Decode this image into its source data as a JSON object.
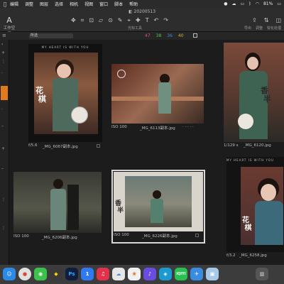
{
  "menubar": {
    "items": [
      "编辑",
      "调整",
      "图层",
      "选择",
      "相机",
      "视图",
      "窗口",
      "脚本",
      "帮助"
    ],
    "battery": "81%"
  },
  "window": {
    "title": "20200513"
  },
  "toolbar": {
    "left_label": "工作空间",
    "tools_label": "光标工具",
    "right_labels": [
      "导出",
      "调整",
      "锐化处理"
    ]
  },
  "filterbar": {
    "filter_value": "所选",
    "counts": [
      {
        "value": "47",
        "color": "#e0557a"
      },
      {
        "value": "38",
        "color": "#52c05a"
      },
      {
        "value": "36",
        "color": "#3a8ce0"
      },
      {
        "value": "40",
        "color": "#e0b13a"
      }
    ]
  },
  "thumbnails": [
    {
      "info": "f/5.6",
      "name": "_MG_6067副本.jpg",
      "banner": "MY HEART IS WITH YOU"
    },
    {
      "info": "ISO 100",
      "name": "_MG_6113副本.jpg"
    },
    {
      "info": "1/129 s",
      "name": "_MG_6120.jpg"
    },
    {
      "info": "ISO 100",
      "name": "_MG_6206副本.jpg"
    },
    {
      "info": "ISO 100",
      "name": "_MG_6226副本.jpg"
    },
    {
      "info": "f/3.2",
      "name": "_MG_6258.jpg",
      "banner": "MY HEART IS WITH YOU"
    }
  ],
  "dock": {
    "apps": [
      "finder",
      "chrome",
      "wechat",
      "penguin",
      "photoshop",
      "baidu",
      "netease-music",
      "baidu-netdisk",
      "capture-one",
      "itunes",
      "sketch",
      "iqiyi",
      "feishu",
      "preview",
      "trash"
    ]
  }
}
